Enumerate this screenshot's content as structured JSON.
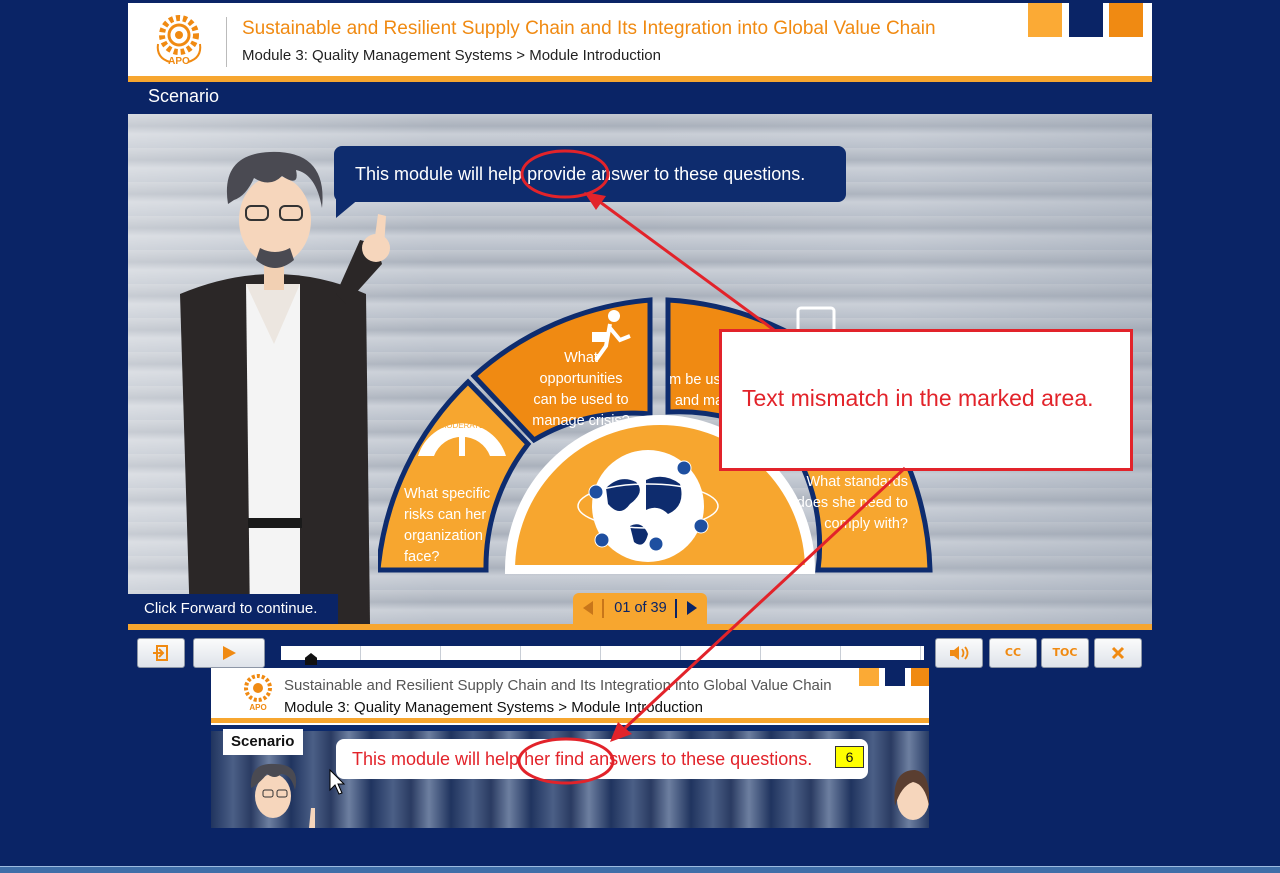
{
  "window": {
    "expand_icon": "»"
  },
  "header": {
    "course_title": "Sustainable and Resilient Supply Chain and Its Integration into Global Value Chain",
    "breadcrumb": "Module 3: Quality Management Systems > Module Introduction",
    "logo_text": "APO",
    "accent_colors": [
      "#fbaa35",
      "#0a2466",
      "#f08a12"
    ]
  },
  "section_title": "Scenario",
  "scene": {
    "speech": "This module will help provide answer to these questions.",
    "questions": {
      "q1": "What specific risks can her organization face?",
      "q2": "What opportunities can be used to manage crisis?",
      "q3": "m be use and ma",
      "q4": "What standards does she need to comply with?"
    },
    "gauge_label": "MODERATE",
    "hint": "Click Forward to continue.",
    "pager": "01 of 39"
  },
  "controls": {
    "exit_icon": "exit-icon",
    "play_icon": "play-icon",
    "volume_icon": "speaker-icon",
    "cc_label": "CC",
    "toc_label": "TOC",
    "close_icon": "close-icon"
  },
  "annotation": {
    "callout": "Text mismatch in the marked area.",
    "color": "#e2232a"
  },
  "reference": {
    "course_title": "Sustainable and Resilient Supply Chain and Its Integration into Global Value Chain",
    "breadcrumb": "Module 3: Quality Management Systems > Module Introduction",
    "section": "Scenario",
    "speech": "This module will help her find answers to these questions.",
    "badge": "6"
  }
}
